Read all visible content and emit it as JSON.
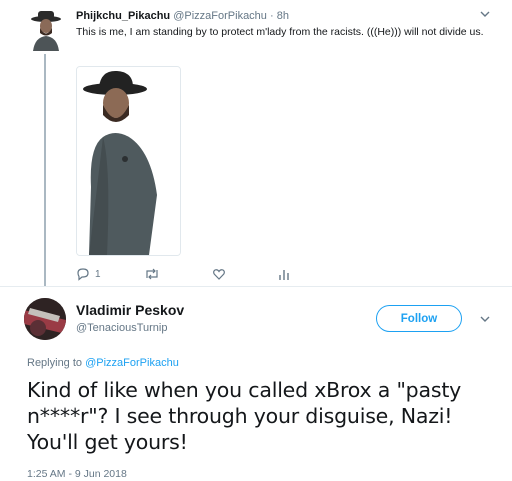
{
  "tweet": {
    "author_name": "Phijkchu_Pikachu",
    "author_handle": "@PizzaForPikachu",
    "time": "8h",
    "text": "This is me, I am standing by to protect m'lady from the racists. (((He))) will not divide us.",
    "actions": {
      "reply_count": "1"
    }
  },
  "reply": {
    "author_name": "Vladimir Peskov",
    "author_handle": "@TenaciousTurnip",
    "follow_label": "Follow",
    "replying_to_prefix": "Replying to",
    "replying_to_handle": "@PizzaForPikachu",
    "text": "Kind of like when you called xBrox a \"pasty n****r\"?  I see through your disguise, Nazi! You'll get yours!",
    "timestamp": "1:25 AM - 9 Jun 2018"
  },
  "colors": {
    "accent": "#1da1f2",
    "muted": "#657786",
    "text": "#14171a"
  },
  "icons": {
    "reply": "reply-icon",
    "retweet": "retweet-icon",
    "like": "heart-icon",
    "analytics": "analytics-icon",
    "menu": "chevron-down-icon"
  }
}
